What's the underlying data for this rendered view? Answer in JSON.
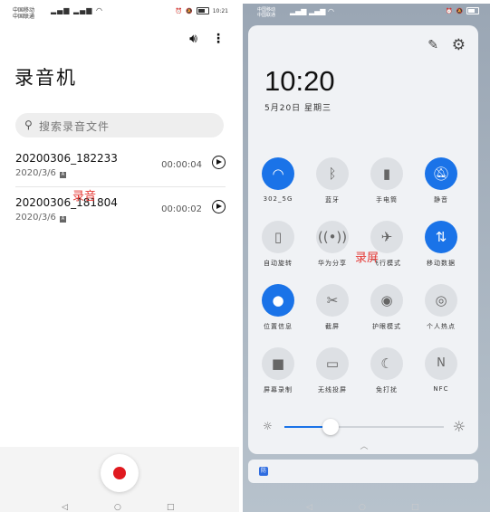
{
  "left_phone": {
    "status_bar": {
      "line1": "中国移动",
      "line2": "中国联通",
      "right": "10:21"
    },
    "app_title": "录音机",
    "search_placeholder": "搜索录音文件",
    "recordings": [
      {
        "name": "20200306_182233",
        "date": "2020/3/6",
        "duration": "00:00:04"
      },
      {
        "name": "20200306_181804",
        "date": "2020/3/6",
        "duration": "00:00:02"
      }
    ],
    "overlay_label": "录音",
    "icons": [
      "volume-icon",
      "more-icon",
      "search-icon",
      "play-icon",
      "record-icon"
    ]
  },
  "right_phone": {
    "status_bar": {
      "line1": "中国移动",
      "line2": "中国联通"
    },
    "time": "10:20",
    "date": "5月20日 星期三",
    "tiles": [
      {
        "label": "302_5G",
        "icon": "wifi-icon",
        "on": true
      },
      {
        "label": "蓝牙",
        "icon": "bluetooth-icon",
        "on": false
      },
      {
        "label": "手电筒",
        "icon": "flashlight-icon",
        "on": false
      },
      {
        "label": "静音",
        "icon": "bell-off-icon",
        "on": true
      },
      {
        "label": "自动旋转",
        "icon": "rotate-icon",
        "on": false
      },
      {
        "label": "华为分享",
        "icon": "share-icon",
        "on": false
      },
      {
        "label": "飞行模式",
        "icon": "airplane-icon",
        "on": false
      },
      {
        "label": "移动数据",
        "icon": "data-icon",
        "on": true
      },
      {
        "label": "位置信息",
        "icon": "location-icon",
        "on": true
      },
      {
        "label": "截屏",
        "icon": "screenshot-icon",
        "on": false
      },
      {
        "label": "护眼模式",
        "icon": "eye-icon",
        "on": false
      },
      {
        "label": "个人热点",
        "icon": "hotspot-icon",
        "on": false
      },
      {
        "label": "屏幕录制",
        "icon": "screen-record-icon",
        "on": false
      },
      {
        "label": "无线投屏",
        "icon": "cast-icon",
        "on": false
      },
      {
        "label": "免打扰",
        "icon": "moon-icon",
        "on": false
      },
      {
        "label": "NFC",
        "icon": "nfc-icon",
        "on": false
      }
    ],
    "overlay_label": "录屏",
    "brightness": 0.29,
    "notification_app": "防"
  },
  "colors": {
    "accent": "#1a73e8",
    "record_red": "#e0191f",
    "overlay_red": "#e53935"
  }
}
